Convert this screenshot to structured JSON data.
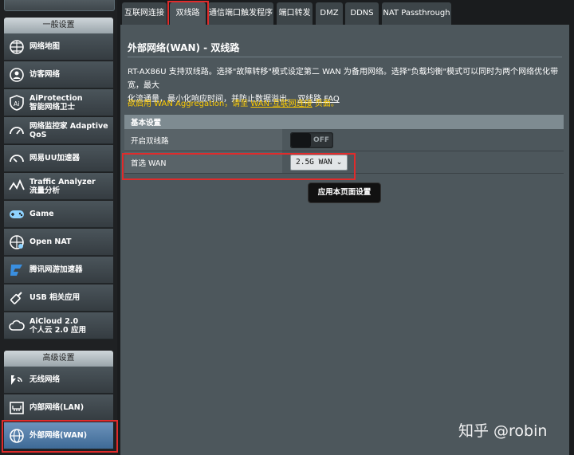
{
  "sidebar": {
    "general_header": "一般设置",
    "advanced_header": "高级设置",
    "general_items": [
      {
        "label": "网络地图",
        "icon": "network-map-icon"
      },
      {
        "label": "访客网络",
        "icon": "guest-network-icon"
      },
      {
        "label": "AiProtection",
        "label2": "智能网络卫士",
        "icon": "aiprotection-icon"
      },
      {
        "label": "网络监控家 Adaptive",
        "label2": "QoS",
        "icon": "qos-gauge-icon"
      },
      {
        "label": "网易UU加速器",
        "icon": "uu-accelerator-icon"
      },
      {
        "label": "Traffic Analyzer",
        "label2": "流量分析",
        "icon": "traffic-analyzer-icon"
      },
      {
        "label": "Game",
        "icon": "gamepad-icon"
      },
      {
        "label": "Open NAT",
        "icon": "open-nat-icon"
      },
      {
        "label": "腾讯网游加速器",
        "icon": "tencent-accelerator-icon"
      },
      {
        "label": "USB 相关应用",
        "icon": "usb-icon"
      },
      {
        "label": "AiCloud 2.0",
        "label2": "个人云 2.0 应用",
        "icon": "aicloud-icon"
      }
    ],
    "advanced_items": [
      {
        "label": "无线网络",
        "icon": "wireless-icon"
      },
      {
        "label": "内部网络(LAN)",
        "icon": "lan-icon"
      },
      {
        "label": "外部网络(WAN)",
        "icon": "wan-globe-icon",
        "active": true
      }
    ]
  },
  "tabs": [
    {
      "label": "互联网连接"
    },
    {
      "label": "双线路",
      "active": true
    },
    {
      "label": "通信端口触发程序"
    },
    {
      "label": "端口转发"
    },
    {
      "label": "DMZ"
    },
    {
      "label": "DDNS"
    },
    {
      "label": "NAT Passthrough"
    }
  ],
  "page": {
    "title": "外部网络(WAN) - 双线路",
    "description_line1": "RT-AX86U 支持双线路。选择\"故障转移\"模式设定第二 WAN 为备用网络。选择\"负载均衡\"模式可以同时为两个网络优化带宽，最大",
    "description_line2": "化流通量，最小化响应时间，并防止数据溢出。",
    "faq_link": "双线路 FAQ",
    "notice_prefix": "欲启用 WAN Aggregation，请至",
    "notice_link": "WAN-互联网连接",
    "notice_suffix": "页面。",
    "section_header": "基本设置",
    "dual_wan_label": "开启双线路",
    "dual_wan_state": "OFF",
    "primary_wan_label": "首选 WAN",
    "primary_wan_value": "2.5G WAN",
    "apply_button": "应用本页面设置"
  },
  "watermark": "知乎 @robin",
  "colors": {
    "highlight_box": "#e02b2b",
    "notice_text": "#ffcc00",
    "active_item": "#4f7daa"
  }
}
